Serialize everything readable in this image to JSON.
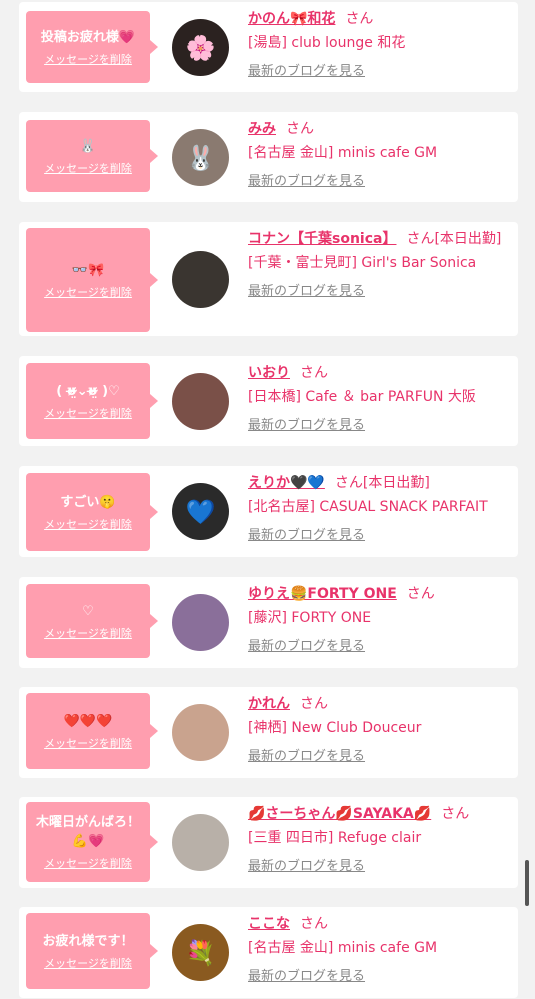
{
  "items": [
    {
      "message": "投稿お疲れ様💗",
      "delete_label": "メッセージを削除",
      "name": "かのん🎀和花",
      "san": "さん",
      "shop": "[湯島] club lounge 和花",
      "blog_label": "最新のブログを見る",
      "avatar_icon": "🌸",
      "avatar_bg": "#2b2220"
    },
    {
      "message": "🐰",
      "delete_label": "メッセージを削除",
      "name": "みみ",
      "san": "さん",
      "shop": "[名古屋 金山] minis cafe GM",
      "blog_label": "最新のブログを見る",
      "avatar_icon": "🐰",
      "avatar_bg": "#8a7a70"
    },
    {
      "message": "👓🎀",
      "delete_label": "メッセージを削除",
      "name": "コナン【千葉sonica】",
      "san": "さん[本日出勤]",
      "shop": "[千葉・富士見町] Girl's Bar Sonica",
      "blog_label": "最新のブログを見る",
      "avatar_icon": "",
      "avatar_bg": "#3a3530"
    },
    {
      "message": "( ʊ̴̶̷̤⌄ʊ̴̶̷̤ )♡",
      "delete_label": "メッセージを削除",
      "name": "いおり",
      "san": "さん",
      "shop": "[日本橋] Cafe ＆ bar PARFUN 大阪",
      "blog_label": "最新のブログを見る",
      "avatar_icon": "",
      "avatar_bg": "#7a5048"
    },
    {
      "message": "すごい🤫",
      "delete_label": "メッセージを削除",
      "name": "えりか🖤💙",
      "san": "さん[本日出勤]",
      "shop": "[北名古屋] CASUAL SNACK PARFAIT",
      "blog_label": "最新のブログを見る",
      "avatar_icon": "💙",
      "avatar_bg": "#2a2a2a"
    },
    {
      "message": "♡",
      "delete_label": "メッセージを削除",
      "name": "ゆりえ🍔FORTY ONE",
      "san": "さん",
      "shop": "[藤沢] FORTY ONE",
      "blog_label": "最新のブログを見る",
      "avatar_icon": "",
      "avatar_bg": "#8a6f9a"
    },
    {
      "message": "❤️❤️❤️",
      "delete_label": "メッセージを削除",
      "name": "かれん",
      "san": "さん",
      "shop": "[神栖] New Club Douceur",
      "blog_label": "最新のブログを見る",
      "avatar_icon": "",
      "avatar_bg": "#c9a38e"
    },
    {
      "message": "木曜日がんばろ！💪💗",
      "delete_label": "メッセージを削除",
      "name": "💋さーちゃん💋SAYAKA💋",
      "san": "さん",
      "shop": "[三重 四日市] Refuge clair",
      "blog_label": "最新のブログを見る",
      "avatar_icon": "",
      "avatar_bg": "#b8b0a8"
    },
    {
      "message": "お疲れ様です！",
      "delete_label": "メッセージを削除",
      "name": "ここな",
      "san": "さん",
      "shop": "[名古屋 金山] minis cafe GM",
      "blog_label": "最新のブログを見る",
      "avatar_icon": "💐",
      "avatar_bg": "#8a5a20"
    }
  ]
}
